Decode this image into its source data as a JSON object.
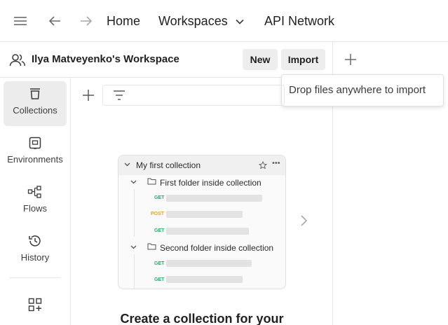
{
  "topbar": {
    "menu_icon": "hamburger-icon",
    "back_icon": "arrow-left-icon",
    "forward_icon": "arrow-right-icon",
    "home": "Home",
    "workspaces": "Workspaces",
    "api_network": "API Network"
  },
  "workspace": {
    "title": "Ilya Matveyenko's Workspace",
    "new_label": "New",
    "import_label": "Import"
  },
  "tooltip": "Drop files anywhere to import",
  "sidebar": {
    "items": [
      {
        "label": "Collections",
        "icon": "collections-icon",
        "active": true
      },
      {
        "label": "Environments",
        "icon": "environments-icon",
        "active": false
      },
      {
        "label": "Flows",
        "icon": "flows-icon",
        "active": false
      },
      {
        "label": "History",
        "icon": "history-icon",
        "active": false
      }
    ],
    "more_icon": "add-apps-icon"
  },
  "preview": {
    "collection_name": "My first collection",
    "folder1": "First folder inside collection",
    "folder2": "Second folder inside collection",
    "methods": [
      "GET",
      "POST",
      "GET",
      "GET",
      "GET"
    ],
    "colors": {
      "get": "#2ea86b",
      "post": "#e0a33b"
    }
  },
  "cta": "Create a collection for your"
}
